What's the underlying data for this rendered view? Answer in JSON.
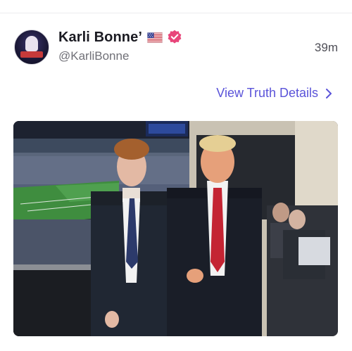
{
  "post": {
    "author": {
      "display_name": "Karli Bonne’",
      "handle": "@KarliBonne",
      "verified": true,
      "flag": "us-flag-icon"
    },
    "timestamp": "39m",
    "details_link": "View Truth Details",
    "media": {
      "type": "photo"
    }
  },
  "colors": {
    "accent": "#5a53d9",
    "verified_badge": "#e8457a",
    "name_text": "#1b1b22",
    "muted_text": "#707077"
  }
}
